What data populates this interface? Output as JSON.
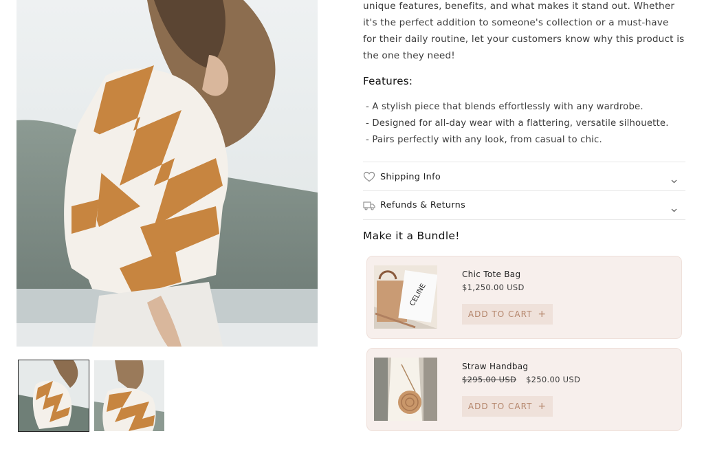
{
  "description": {
    "lines": [
      "unique features, benefits, and what makes it stand out. Whether",
      "it's the perfect addition to someone's collection or a must-have",
      "for their daily routine, let your customers know why this product is",
      "the one they need!"
    ]
  },
  "features": {
    "title": "Features:",
    "items": [
      "- A stylish piece that blends effortlessly with any wardrobe.",
      "- Designed for all-day wear with a flattering, versatile silhouette.",
      "- Pairs perfectly with any look, from casual to chic."
    ]
  },
  "accordions": [
    {
      "label": "Shipping Info",
      "icon": "heart-icon"
    },
    {
      "label": "Refunds & Returns",
      "icon": "truck-icon"
    }
  ],
  "bundle": {
    "title": "Make it a Bundle!",
    "products": [
      {
        "name": "Chic Tote Bag",
        "price": "$1,250.00 USD",
        "compare_price": "",
        "button": "ADD TO CART",
        "image_text": "CELINE"
      },
      {
        "name": "Straw Handbag",
        "price": "$250.00 USD",
        "compare_price": "$295.00 USD",
        "button": "ADD TO CART"
      }
    ]
  },
  "gallery": {
    "main_image": "woman-in-orange-white-chevron-sweater",
    "thumbnails": [
      "thumbnail-1",
      "thumbnail-2"
    ]
  },
  "colors": {
    "accent_text": "#b4856b",
    "card_bg": "#f7efec",
    "button_bg": "#efe1da"
  }
}
